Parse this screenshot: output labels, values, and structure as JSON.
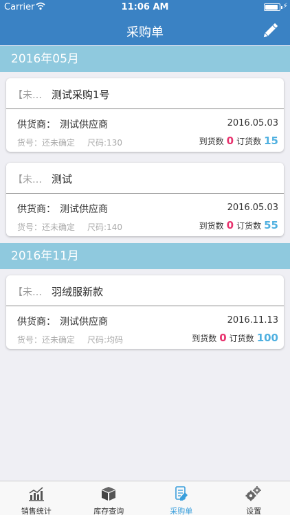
{
  "status_bar": {
    "carrier": "Carrier",
    "time": "11:06 AM",
    "battery_level": 0.9
  },
  "nav": {
    "title": "采购单"
  },
  "sections": [
    {
      "header": "2016年05月"
    },
    {
      "header": "2016年11月"
    }
  ],
  "orders": [
    {
      "status": "【未…",
      "title": "测试采购1号",
      "supplier_label": "供货商：",
      "supplier": "测试供应商",
      "date": "2016.05.03",
      "sku": "货号：还未确定",
      "size": "尺码:130",
      "arrived_label": "到货数",
      "arrived": "0",
      "ordered_label": "订货数",
      "ordered": "15"
    },
    {
      "status": "【未…",
      "title": "测试",
      "supplier_label": "供货商：",
      "supplier": "测试供应商",
      "date": "2016.05.03",
      "sku": "货号：还未确定",
      "size": "尺码:140",
      "arrived_label": "到货数",
      "arrived": "0",
      "ordered_label": "订货数",
      "ordered": "55"
    },
    {
      "status": "【未…",
      "title": "羽绒服新款",
      "supplier_label": "供货商：",
      "supplier": "测试供应商",
      "date": "2016.11.13",
      "sku": "货号：还未确定",
      "size": "尺码:均码",
      "arrived_label": "到货数",
      "arrived": "0",
      "ordered_label": "订货数",
      "ordered": "100"
    }
  ],
  "tabs": [
    {
      "label": "销售统计",
      "icon": "bar-chart-icon"
    },
    {
      "label": "库存查询",
      "icon": "box-icon"
    },
    {
      "label": "采购单",
      "icon": "document-edit-icon",
      "active": true
    },
    {
      "label": "设置",
      "icon": "gears-icon"
    }
  ],
  "colors": {
    "nav": "#3a82c4",
    "section": "#8fc9de",
    "arrived": "#e8336e",
    "ordered": "#4fb0e0",
    "active_tab": "#3a9fdc"
  }
}
